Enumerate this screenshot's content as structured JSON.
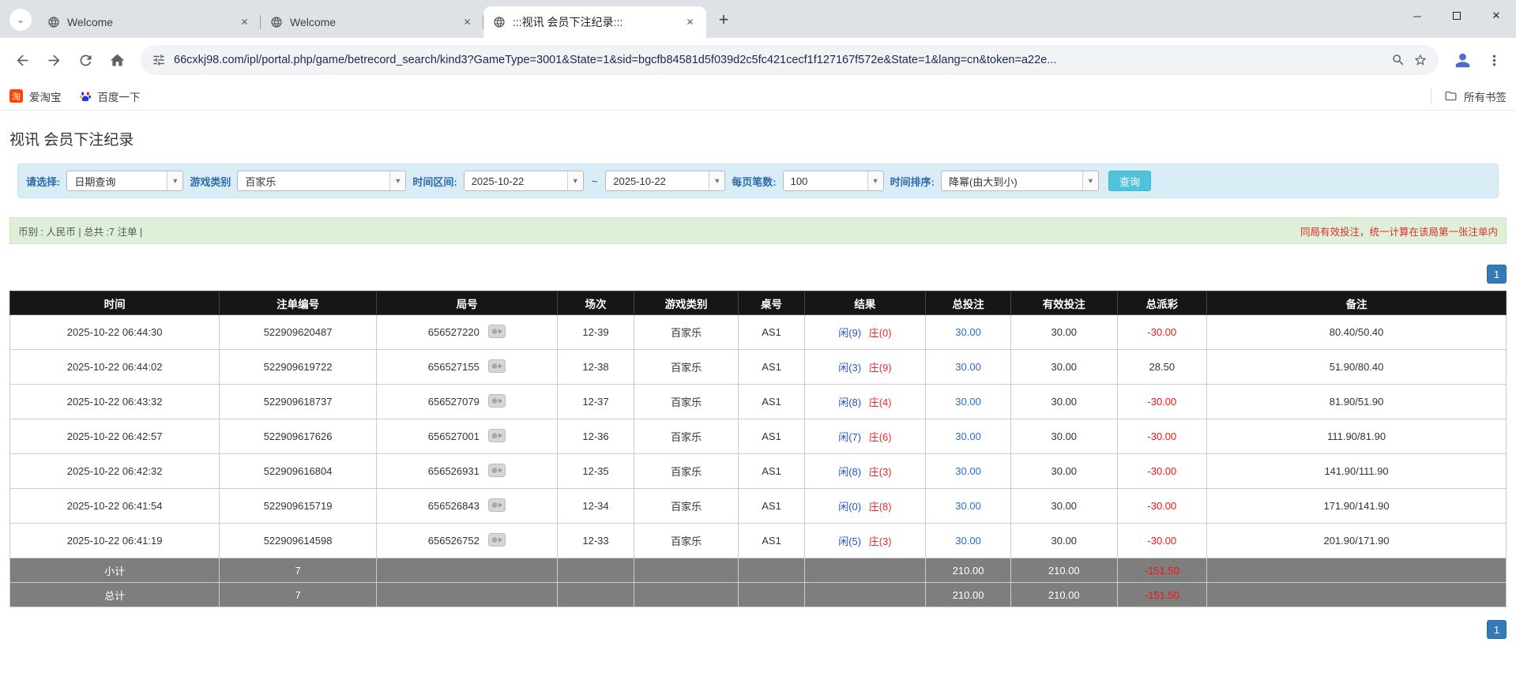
{
  "browser": {
    "tabs": [
      {
        "title": "Welcome"
      },
      {
        "title": "Welcome"
      },
      {
        "title": ":::视讯 会员下注纪录:::"
      }
    ],
    "new_tab_label": "+",
    "url": "66cxkj98.com/ipl/portal.php/game/betrecord_search/kind3?GameType=3001&State=1&sid=bgcfb84581d5f039d2c5fc421cecf1f127167f572e&State=1&lang=cn&token=a22e...",
    "bookmarks": [
      {
        "label": "爱淘宝",
        "icon": "taobao-icon"
      },
      {
        "label": "百度一下",
        "icon": "baidu-icon"
      }
    ],
    "all_bookmarks_label": "所有书签"
  },
  "icons": {
    "tab_favicon": "globe-icon",
    "navigation": [
      "back-icon",
      "forward-icon",
      "reload-icon",
      "home-icon"
    ],
    "urlbar": [
      "tune-icon",
      "zoom-icon",
      "star-icon"
    ],
    "right": [
      "profile-icon",
      "menu-icon"
    ],
    "bookmarks_right": "folder-icon",
    "round_cell": "replay-thumbnail-icon"
  },
  "colors": {
    "accent_blue": "#337ab7",
    "bet_link_blue": "#2a6bd4",
    "player_blue": "#2353cc",
    "banker_red": "#e02b2b",
    "negative_red": "#ff1010",
    "table_header_bg": "#161616",
    "filter_bg": "#d9edf7",
    "info_bg": "#dff0d8",
    "query_button": "#4fc3dc",
    "summary_bg": "#7e7e7e"
  },
  "page": {
    "title": "视讯 会员下注纪录",
    "filter": {
      "select_label": "请选择:",
      "select_value": "日期查询",
      "game_type_label": "游戏类别",
      "game_type_value": "百家乐",
      "date_range_label": "时间区间:",
      "date_from": "2025-10-22",
      "tilde": "~",
      "date_to": "2025-10-22",
      "page_size_label": "每页笔数:",
      "page_size_value": "100",
      "sort_label": "时间排序:",
      "sort_value": "降幂(由大到小)",
      "query_button": "查询"
    },
    "summary_bar": {
      "left": "币别 : 人民币 | 总共 :7 注单 |",
      "right": "同局有效投注，统一计算在该局第一张注单内"
    },
    "pagination": "1",
    "table": {
      "headers": [
        "时间",
        "注单编号",
        "局号",
        "场次",
        "游戏类别",
        "桌号",
        "结果",
        "总投注",
        "有效投注",
        "总派彩",
        "备注"
      ],
      "rows": [
        {
          "time": "2025-10-22 06:44:30",
          "bet_id": "522909620487",
          "round": "656527220",
          "session": "12-39",
          "game": "百家乐",
          "table_no": "AS1",
          "result_player": "闲(9)",
          "result_banker": "庄(0)",
          "total_bet": "30.00",
          "valid_bet": "30.00",
          "payout": "-30.00",
          "remark": "80.40/50.40"
        },
        {
          "time": "2025-10-22 06:44:02",
          "bet_id": "522909619722",
          "round": "656527155",
          "session": "12-38",
          "game": "百家乐",
          "table_no": "AS1",
          "result_player": "闲(3)",
          "result_banker": "庄(9)",
          "total_bet": "30.00",
          "valid_bet": "30.00",
          "payout": "28.50",
          "remark": "51.90/80.40"
        },
        {
          "time": "2025-10-22 06:43:32",
          "bet_id": "522909618737",
          "round": "656527079",
          "session": "12-37",
          "game": "百家乐",
          "table_no": "AS1",
          "result_player": "闲(8)",
          "result_banker": "庄(4)",
          "total_bet": "30.00",
          "valid_bet": "30.00",
          "payout": "-30.00",
          "remark": "81.90/51.90"
        },
        {
          "time": "2025-10-22 06:42:57",
          "bet_id": "522909617626",
          "round": "656527001",
          "session": "12-36",
          "game": "百家乐",
          "table_no": "AS1",
          "result_player": "闲(7)",
          "result_banker": "庄(6)",
          "total_bet": "30.00",
          "valid_bet": "30.00",
          "payout": "-30.00",
          "remark": "111.90/81.90"
        },
        {
          "time": "2025-10-22 06:42:32",
          "bet_id": "522909616804",
          "round": "656526931",
          "session": "12-35",
          "game": "百家乐",
          "table_no": "AS1",
          "result_player": "闲(8)",
          "result_banker": "庄(3)",
          "total_bet": "30.00",
          "valid_bet": "30.00",
          "payout": "-30.00",
          "remark": "141.90/111.90"
        },
        {
          "time": "2025-10-22 06:41:54",
          "bet_id": "522909615719",
          "round": "656526843",
          "session": "12-34",
          "game": "百家乐",
          "table_no": "AS1",
          "result_player": "闲(0)",
          "result_banker": "庄(8)",
          "total_bet": "30.00",
          "valid_bet": "30.00",
          "payout": "-30.00",
          "remark": "171.90/141.90"
        },
        {
          "time": "2025-10-22 06:41:19",
          "bet_id": "522909614598",
          "round": "656526752",
          "session": "12-33",
          "game": "百家乐",
          "table_no": "AS1",
          "result_player": "闲(5)",
          "result_banker": "庄(3)",
          "total_bet": "30.00",
          "valid_bet": "30.00",
          "payout": "-30.00",
          "remark": "201.90/171.90"
        }
      ],
      "subtotal": {
        "label": "小计",
        "count": "7",
        "total_bet": "210.00",
        "valid_bet": "210.00",
        "payout": "-151.50"
      },
      "total": {
        "label": "总计",
        "count": "7",
        "total_bet": "210.00",
        "valid_bet": "210.00",
        "payout": "-151.50"
      }
    }
  }
}
